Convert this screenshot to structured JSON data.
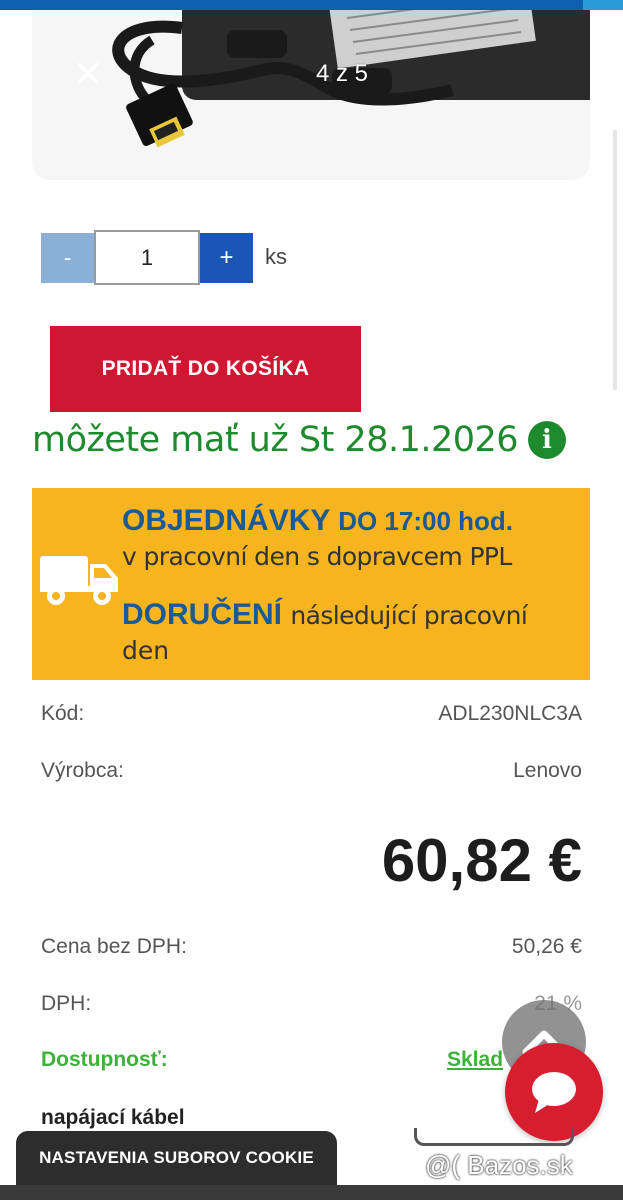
{
  "gallery": {
    "counter": "4 z 5",
    "close_glyph": "✕"
  },
  "quantity": {
    "minus_label": "-",
    "value": "1",
    "plus_label": "+",
    "unit": "ks"
  },
  "cart": {
    "add_label": "PRIDAŤ DO KOŠÍKA"
  },
  "delivery": {
    "text": "môžete mať už St 28.1.2026",
    "info_glyph": "i"
  },
  "banner": {
    "line1_strong": "OBJEDNÁVKY",
    "line1_rest": "DO 17:00 hod.",
    "line2": "v pracovní den s dopravcem PPL",
    "line3_strong": "DORUČENÍ",
    "line3_rest": "následující pracovní",
    "line4": "den"
  },
  "details": {
    "code_label": "Kód:",
    "code_value": "ADL230NLC3A",
    "maker_label": "Výrobca:",
    "maker_value": "Lenovo",
    "price": "60,82 €",
    "net_label": "Cena bez DPH:",
    "net_value": "50,26 €",
    "vat_label": "DPH:",
    "vat_value": "21 %",
    "availability_label": "Dostupnosť:",
    "availability_value": "Sklad",
    "cable_label": "napájací kábel"
  },
  "cookie": {
    "label": "NASTAVENIA SUBOROV COOKIE"
  },
  "watermark": {
    "text": "@( Bazos.sk"
  },
  "colors": {
    "primary_blue": "#1a56b4",
    "cart_red": "#cf1732",
    "delivery_green": "#1e8a2e",
    "banner_yellow": "#f6b51e",
    "banner_blue": "#1b5a94",
    "stock_green": "#3db23a"
  }
}
